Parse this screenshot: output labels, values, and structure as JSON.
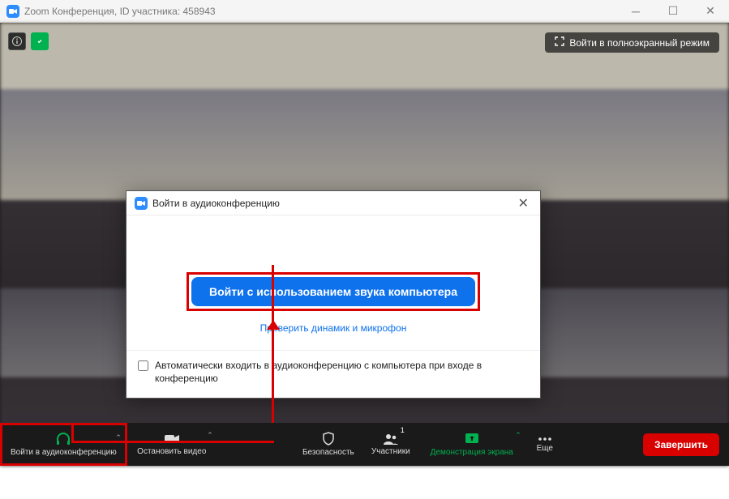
{
  "titlebar": {
    "title": "Zoom Конференция, ID участника: 458943"
  },
  "fullscreen_label": "Войти в полноэкранный режим",
  "dialog": {
    "title": "Войти в аудиоконференцию",
    "primary_btn": "Войти с использованием звука компьютера",
    "test_link": "Проверить динамик и микрофон",
    "auto_join_label": "Автоматически входить в аудиоконференцию с компьютера при входе в конференцию"
  },
  "toolbar": {
    "audio": "Войти в аудиоконференцию",
    "video": "Остановить видео",
    "security": "Безопасность",
    "participants": "Участники",
    "participants_count": "1",
    "share": "Демонстрация экрана",
    "more": "Еще",
    "end": "Завершить"
  }
}
